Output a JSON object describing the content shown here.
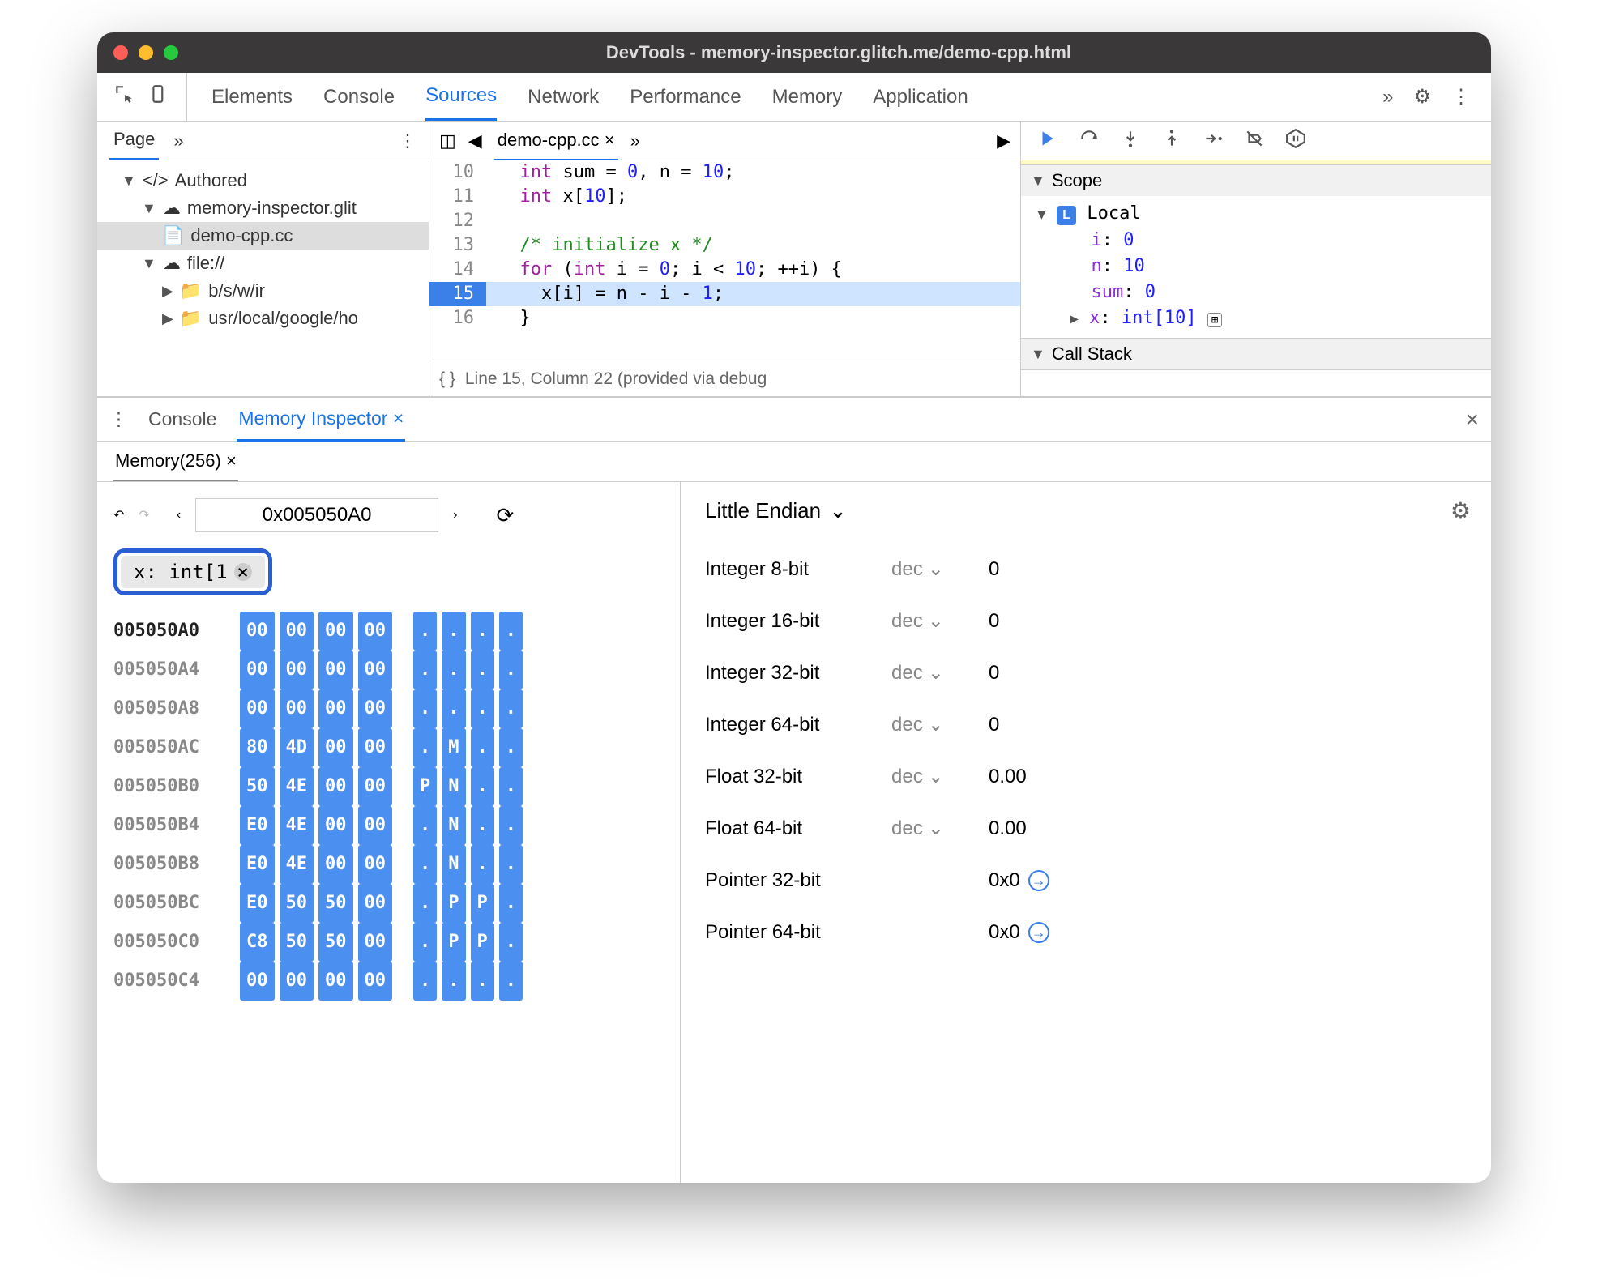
{
  "window": {
    "title": "DevTools - memory-inspector.glitch.me/demo-cpp.html"
  },
  "toolbar": {
    "tabs": [
      "Elements",
      "Console",
      "Sources",
      "Network",
      "Performance",
      "Memory",
      "Application"
    ],
    "active": "Sources",
    "more": "»"
  },
  "sidebar": {
    "page_label": "Page",
    "more": "»",
    "tree": {
      "root": "Authored",
      "domain": "memory-inspector.glit",
      "file": "demo-cpp.cc",
      "file_scheme": "file://",
      "folder1": "b/s/w/ir",
      "folder2": "usr/local/google/ho"
    }
  },
  "editor": {
    "filename": "demo-cpp.cc",
    "more": "»",
    "lines": [
      {
        "n": 10,
        "text": "  int sum = 0, n = 10;"
      },
      {
        "n": 11,
        "text": "  int x[10];"
      },
      {
        "n": 12,
        "text": ""
      },
      {
        "n": 13,
        "text": "  /* initialize x */"
      },
      {
        "n": 14,
        "text": "  for (int i = 0; i < 10; ++i) {"
      },
      {
        "n": 15,
        "text": "    x[i] = n - i - 1;",
        "current": true
      },
      {
        "n": 16,
        "text": "  }"
      }
    ],
    "status": "Line 15, Column 22 (provided via debug"
  },
  "debug": {
    "scope_label": "Scope",
    "local_label": "Local",
    "vars": [
      {
        "name": "i",
        "value": "0"
      },
      {
        "name": "n",
        "value": "10"
      },
      {
        "name": "sum",
        "value": "0"
      },
      {
        "name": "x",
        "value": "int[10]",
        "expandable": true
      }
    ],
    "callstack_label": "Call Stack"
  },
  "drawer": {
    "tabs": [
      "Console",
      "Memory Inspector"
    ],
    "active": "Memory Inspector",
    "mem_tab": "Memory(256)"
  },
  "memory": {
    "address": "0x005050A0",
    "chip": "x: int[1",
    "chip_close": "×",
    "endian": "Little Endian",
    "rows": [
      {
        "addr": "005050A0",
        "bytes": [
          "00",
          "00",
          "00",
          "00"
        ],
        "ascii": [
          ".",
          ".",
          ".",
          "."
        ]
      },
      {
        "addr": "005050A4",
        "bytes": [
          "00",
          "00",
          "00",
          "00"
        ],
        "ascii": [
          ".",
          ".",
          ".",
          "."
        ]
      },
      {
        "addr": "005050A8",
        "bytes": [
          "00",
          "00",
          "00",
          "00"
        ],
        "ascii": [
          ".",
          ".",
          ".",
          "."
        ]
      },
      {
        "addr": "005050AC",
        "bytes": [
          "80",
          "4D",
          "00",
          "00"
        ],
        "ascii": [
          ".",
          "M",
          ".",
          "."
        ]
      },
      {
        "addr": "005050B0",
        "bytes": [
          "50",
          "4E",
          "00",
          "00"
        ],
        "ascii": [
          "P",
          "N",
          ".",
          "."
        ]
      },
      {
        "addr": "005050B4",
        "bytes": [
          "E0",
          "4E",
          "00",
          "00"
        ],
        "ascii": [
          ".",
          "N",
          ".",
          "."
        ]
      },
      {
        "addr": "005050B8",
        "bytes": [
          "E0",
          "4E",
          "00",
          "00"
        ],
        "ascii": [
          ".",
          "N",
          ".",
          "."
        ]
      },
      {
        "addr": "005050BC",
        "bytes": [
          "E0",
          "50",
          "50",
          "00"
        ],
        "ascii": [
          ".",
          "P",
          "P",
          "."
        ]
      },
      {
        "addr": "005050C0",
        "bytes": [
          "C8",
          "50",
          "50",
          "00"
        ],
        "ascii": [
          ".",
          "P",
          "P",
          "."
        ]
      },
      {
        "addr": "005050C4",
        "bytes": [
          "00",
          "00",
          "00",
          "00"
        ],
        "ascii": [
          ".",
          ".",
          ".",
          "."
        ]
      }
    ],
    "values": [
      {
        "label": "Integer 8-bit",
        "fmt": "dec",
        "val": "0",
        "dd": true
      },
      {
        "label": "Integer 16-bit",
        "fmt": "dec",
        "val": "0",
        "dd": true
      },
      {
        "label": "Integer 32-bit",
        "fmt": "dec",
        "val": "0",
        "dd": true
      },
      {
        "label": "Integer 64-bit",
        "fmt": "dec",
        "val": "0",
        "dd": true
      },
      {
        "label": "Float 32-bit",
        "fmt": "dec",
        "val": "0.00",
        "dd": true
      },
      {
        "label": "Float 64-bit",
        "fmt": "dec",
        "val": "0.00",
        "dd": true
      },
      {
        "label": "Pointer 32-bit",
        "fmt": "",
        "val": "0x0",
        "jump": true
      },
      {
        "label": "Pointer 64-bit",
        "fmt": "",
        "val": "0x0",
        "jump": true
      }
    ]
  }
}
